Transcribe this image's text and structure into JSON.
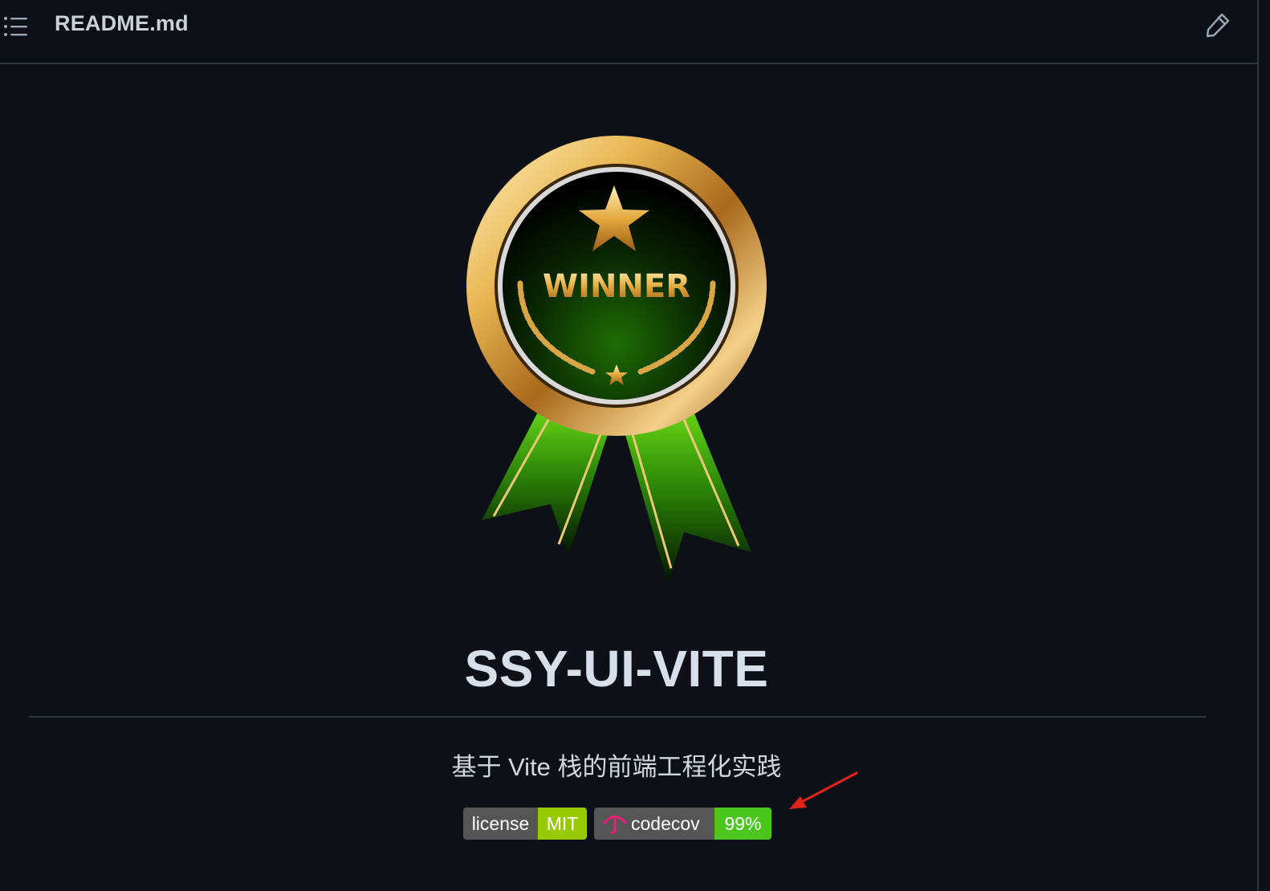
{
  "header": {
    "file_name": "README.md",
    "toc_icon": "list-icon",
    "edit_icon": "pencil-icon"
  },
  "logo": {
    "text": "WINNER",
    "icon": "winner-medal-icon"
  },
  "readme": {
    "title": "SSY-UI-VITE",
    "tagline": "基于 Vite 栈的前端工程化实践"
  },
  "badges": {
    "license": {
      "label": "license",
      "value": "MIT",
      "value_color": "#97ca00"
    },
    "codecov": {
      "label": "codecov",
      "value": "99%",
      "value_color": "#4cc61e",
      "icon": "codecov-umbrella-icon"
    }
  },
  "annotation": {
    "icon": "red-arrow-icon",
    "color": "#e0241b"
  }
}
